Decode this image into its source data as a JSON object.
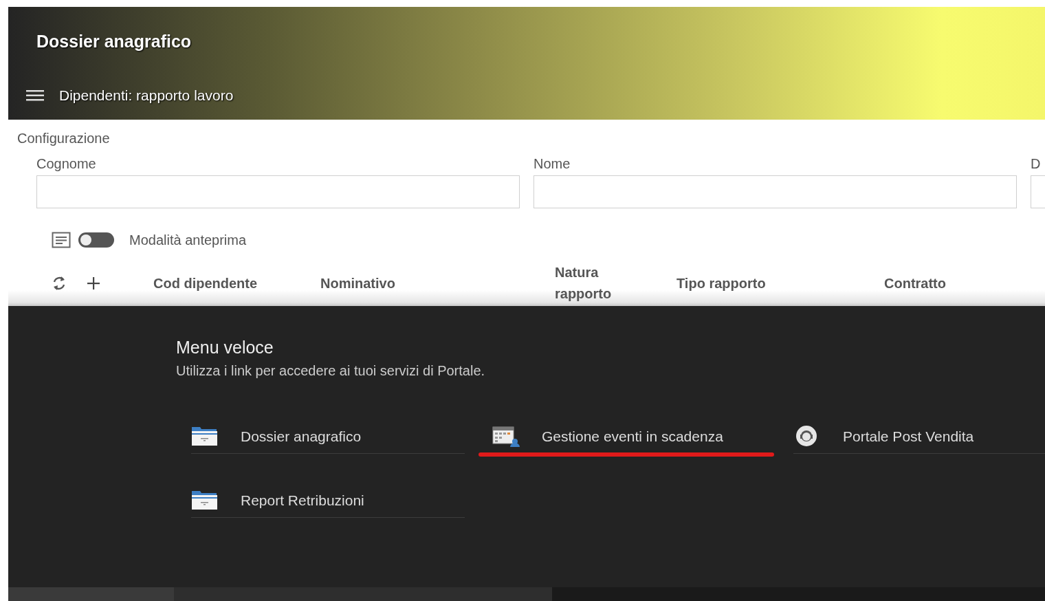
{
  "header": {
    "title": "Dossier anagrafico",
    "subtitle": "Dipendenti: rapporto lavoro"
  },
  "section_title": "Configurazione",
  "fields": [
    {
      "label": "Cognome"
    },
    {
      "label": "Nome"
    },
    {
      "label": "D"
    }
  ],
  "preview_toggle": {
    "label": "Modalità anteprima",
    "on": false
  },
  "table": {
    "columns": [
      "Cod dipendente",
      "Nominativo",
      "Natura rapporto",
      "Tipo rapporto",
      "Contratto"
    ]
  },
  "quick_menu": {
    "title": "Menu veloce",
    "subtitle": "Utilizza i link per accedere ai tuoi servizi di Portale.",
    "items": [
      {
        "label": "Dossier anagrafico",
        "kind": "folder",
        "highlighted": false
      },
      {
        "label": "Gestione eventi in scadenza",
        "kind": "calendar",
        "highlighted": true
      },
      {
        "label": "Portale Post Vendita",
        "kind": "support",
        "highlighted": false
      },
      {
        "label": "Report Retribuzioni",
        "kind": "folder",
        "highlighted": false
      }
    ]
  }
}
